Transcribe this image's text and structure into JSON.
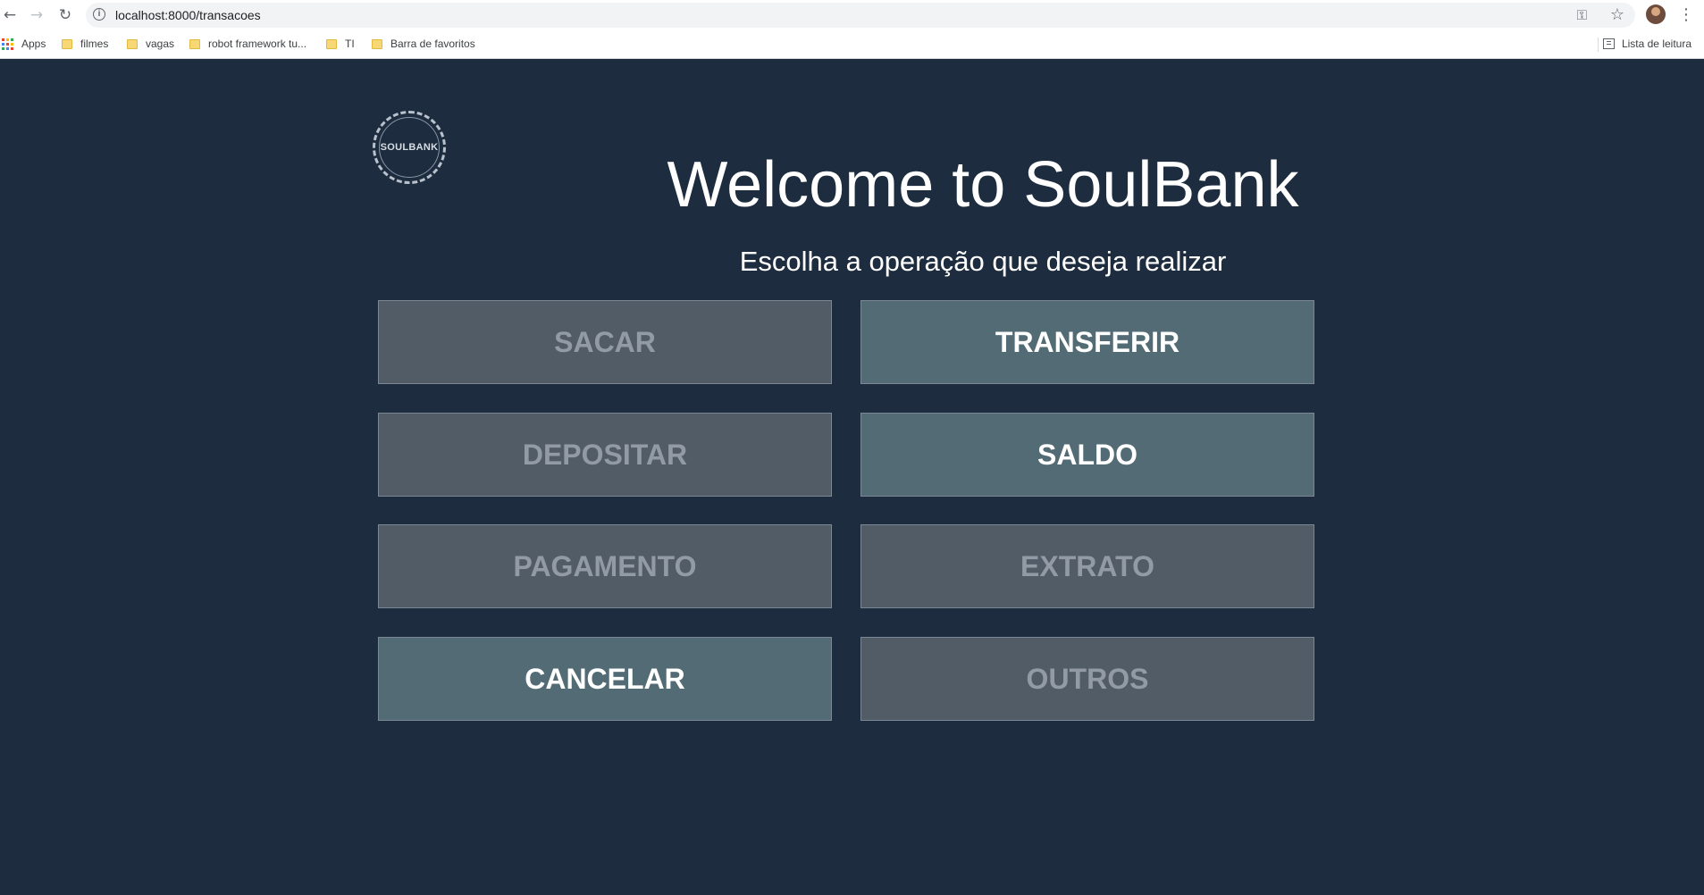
{
  "browser": {
    "url": "localhost:8000/transacoes",
    "nav_icons": [
      "back-arrow-icon",
      "forward-arrow-icon",
      "reload-icon"
    ],
    "bookmarks": [
      {
        "label": "Apps",
        "icon": "apps-grid-icon"
      },
      {
        "label": "filmes",
        "icon": "folder-icon"
      },
      {
        "label": "vagas",
        "icon": "folder-icon"
      },
      {
        "label": "robot framework tu...",
        "icon": "folder-icon"
      },
      {
        "label": "TI",
        "icon": "folder-icon"
      },
      {
        "label": "Barra de favoritos",
        "icon": "folder-icon"
      }
    ],
    "reading_list_label": "Lista de leitura"
  },
  "page": {
    "logo_text": "SOULBANK",
    "title": "Welcome to SoulBank",
    "subtitle": "Escolha a operação que deseja realizar",
    "background_color": "#1d2d3f"
  },
  "operations": [
    {
      "label": "SACAR",
      "state": "muted"
    },
    {
      "label": "TRANSFERIR",
      "state": "active"
    },
    {
      "label": "DEPOSITAR",
      "state": "muted"
    },
    {
      "label": "SALDO",
      "state": "active"
    },
    {
      "label": "PAGAMENTO",
      "state": "muted"
    },
    {
      "label": "EXTRATO",
      "state": "muted"
    },
    {
      "label": "CANCELAR",
      "state": "active"
    },
    {
      "label": "OUTROS",
      "state": "muted"
    }
  ],
  "colors": {
    "button_muted_bg": "#515c67",
    "button_muted_text": "#929ba5",
    "button_active_bg": "#526b75",
    "button_active_text": "#ffffff"
  }
}
